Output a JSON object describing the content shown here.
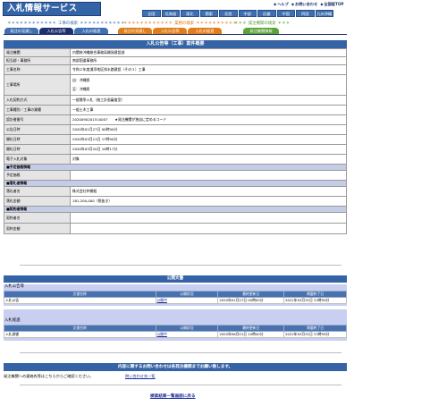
{
  "header": {
    "logo": "入札情報サービス",
    "top_links": [
      "ヘルプ",
      "お問い合わせ",
      "全国版TOP"
    ],
    "regions": [
      "全国",
      "北海道",
      "東北",
      "関東",
      "北陸",
      "中部",
      "近畿",
      "中国",
      "四国",
      "九州沖縄"
    ]
  },
  "search": {
    "construction_label": "工事の検索",
    "business_label": "業務の検索",
    "agency_label": "発注機関の検索",
    "construction_tabs": [
      "発注の見通し",
      "入札公告等",
      "入札の経過"
    ],
    "business_tabs": [
      "発注の見通し",
      "入札公告等",
      "入札の経過"
    ],
    "agency_tabs": [
      "発注機関情報"
    ]
  },
  "main": {
    "title": "入札公告等（工事）案件概要",
    "rows": [
      {
        "k": "発注機関",
        "v": "内閣府沖縄総合事務局開発建設部"
      },
      {
        "k": "担当部・事務所",
        "v": "南部国道事務所"
      },
      {
        "k": "工事名称",
        "v": "令和２年度浦添地区排水路建設（その１）工事"
      },
      {
        "k": "工事場所",
        "v": "自：沖縄県",
        "v2": "至：沖縄県"
      },
      {
        "k": "入札契約方式",
        "v": "一般競争入札（施工計画審査型）"
      },
      {
        "k": "工事種別／工事の業種",
        "v": "一般土木工事"
      },
      {
        "k": "設計書番号",
        "v": "2020090201510007　　★発注機関が独自に定めるコード"
      },
      {
        "k": "公告日時",
        "v": "2020年01月27日 00時00分"
      },
      {
        "k": "開札日時",
        "v": "2020年03月13日 17時00分"
      },
      {
        "k": "開札日時",
        "v": "2020年03月20日 10時17分"
      },
      {
        "k": "電子入札対象",
        "v": "対象"
      }
    ],
    "sections": [
      {
        "title": "■予定価格情報",
        "rows": [
          {
            "k": "予定価格",
            "v": ""
          }
        ]
      },
      {
        "title": "■落札者情報",
        "rows": [
          {
            "k": "落札者名",
            "v": "株式会社仲開組"
          },
          {
            "k": "落札金額",
            "v": "181,200,000（税抜き）"
          }
        ]
      },
      {
        "title": "■契約者情報",
        "rows": [
          {
            "k": "契約者名",
            "v": ""
          },
          {
            "k": "契約金額",
            "v": ""
          }
        ]
      }
    ]
  },
  "docs": {
    "title": "公開文書",
    "notice_section": "入札公告等",
    "progress_section": "入札経過",
    "columns": [
      "文書名称",
      "公開状況",
      "最終更新日",
      "掲載終了日"
    ],
    "notice_rows": [
      [
        "入札公告",
        "公開中",
        "2020年01月27日 00時00分",
        "2021年03月31日 23時59分"
      ]
    ],
    "progress_rows": [
      [
        "入札調書",
        "公開中",
        "2020年06月01日 10時40分",
        "2022年03月31日 23時59分"
      ]
    ]
  },
  "contact": {
    "bar": "内容に関するお問い合わせは各発注機関までお願い致します。",
    "label": "発注機関への連絡先等はこちらからご確認ください。",
    "link": "問い合わせ先一覧"
  },
  "back_link": "検索結果一覧画面に戻る",
  "colors": {
    "brand": "#3463a6",
    "construction": "#3f6fb1",
    "business": "#e07d1a",
    "agency": "#5aa23a"
  }
}
